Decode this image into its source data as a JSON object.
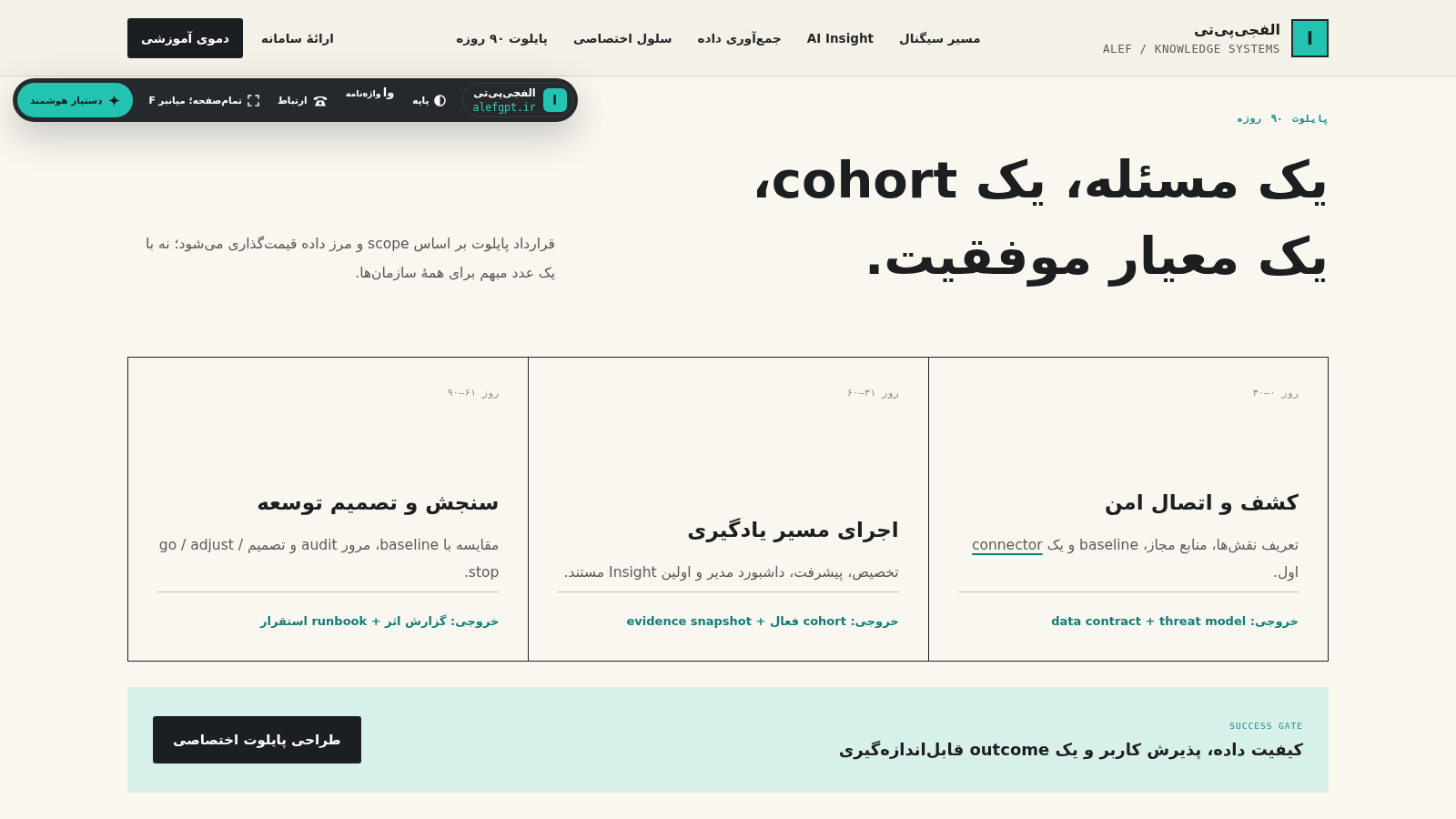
{
  "header": {
    "brand": {
      "logo": "ا",
      "name": "الفجی‌پی‌تی",
      "tagline": "ALEF / KNOWLEDGE SYSTEMS"
    },
    "nav": [
      {
        "label": "مسیر سیگنال"
      },
      {
        "label": "AI Insight"
      },
      {
        "label": "جمع‌آوری داده"
      },
      {
        "label": "سلول اختصاصی"
      },
      {
        "label": "پایلوت ۹۰ روزه"
      }
    ],
    "link": "ارائهٔ سامانه",
    "cta": "دموی آموزشی"
  },
  "toolbar": {
    "brand": {
      "logo": "ا",
      "name": "الفجی‌پی‌تی",
      "domain": "alefgpt.ir"
    },
    "theme": {
      "label": "پایه"
    },
    "glossary": {
      "glyph": "وا",
      "label": "واژه‌نامه"
    },
    "contact": {
      "label": "ارتباط"
    },
    "fullscreen": {
      "label": "تمام‌صفحه؛ میانبر F"
    },
    "assistant": {
      "label": "دستیار هوشمند"
    }
  },
  "hero": {
    "eyebrow": "پایلوت ۹۰ روزه",
    "headline": [
      "یک مسئله، یک cohort،",
      "یک معیار موفقیت."
    ],
    "lead": "قرارداد پایلوت بر اساس scope و مرز داده قیمت‌گذاری می‌شود؛ نه با یک عدد مبهم برای همهٔ سازمان‌ها."
  },
  "phases": [
    {
      "days": "روز ۰–۳۰",
      "title": "کشف و اتصال امن",
      "description": [
        {
          "kind": "text",
          "text": "تعریف نقش‌ها، منابع مجاز، baseline و یک "
        },
        {
          "kind": "link",
          "text": "connector"
        },
        {
          "kind": "text",
          "text": " اول."
        }
      ],
      "output": "خروجی: data contract + threat model"
    },
    {
      "days": "روز ۳۱–۶۰",
      "title": "اجرای مسیر یادگیری",
      "description": [
        {
          "kind": "text",
          "text": "تخصیص، پیشرفت، داشبورد مدیر و اولین Insight مستند."
        }
      ],
      "output": "خروجی: cohort فعال + evidence snapshot"
    },
    {
      "days": "روز ۶۱–۹۰",
      "title": "سنجش و تصمیم توسعه",
      "description": [
        {
          "kind": "text",
          "text": "مقایسه با baseline، مرور audit و تصمیم go / adjust / stop."
        }
      ],
      "output": "خروجی: گزارش اثر + runbook استقرار"
    }
  ],
  "success_gate": {
    "eyebrow": "SUCCESS GATE",
    "title": "کیفیت داده، پذیرش کاربر و یک outcome قابل‌اندازه‌گیری",
    "cta": "طراحی پایلوت اختصاصی"
  }
}
